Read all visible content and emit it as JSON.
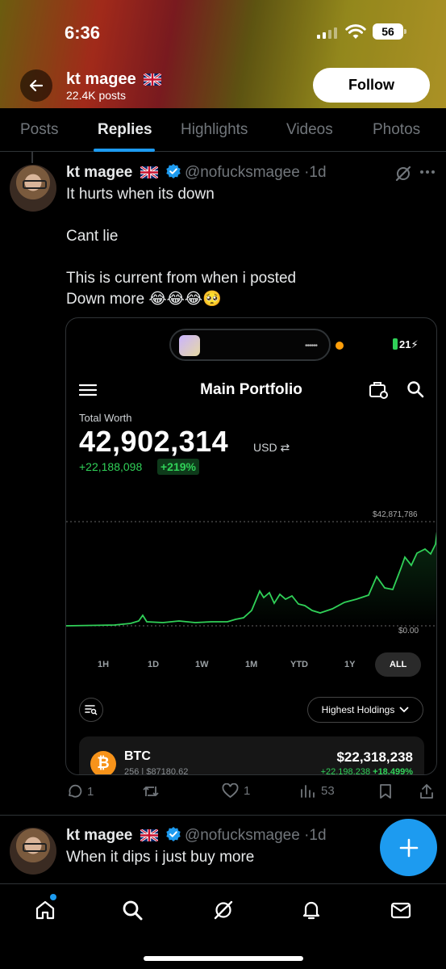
{
  "status_bar": {
    "time": "6:36",
    "battery": "56"
  },
  "header": {
    "name": "kt magee",
    "posts_count": "22.4K posts",
    "follow_label": "Follow"
  },
  "tabs": [
    {
      "label": "Posts"
    },
    {
      "label": "Replies"
    },
    {
      "label": "Highlights"
    },
    {
      "label": "Videos"
    },
    {
      "label": "Photos"
    }
  ],
  "active_tab": "Replies",
  "tweets": [
    {
      "name": "kt magee",
      "handle": "@nofucksmagee",
      "sep": "·",
      "time": "1d",
      "text": "It hurts when its down\n\nCant lie\n\nThis is current from when i posted\nDown more 😂😂😂🥺",
      "stats": {
        "replies": "1",
        "reposts": "",
        "likes": "1",
        "views": "53"
      }
    },
    {
      "name": "kt magee",
      "handle": "@nofucksmagee",
      "sep": "·",
      "time": "1d",
      "text": "When it dips i just buy more"
    }
  ],
  "portfolio": {
    "phone_battery": "21",
    "title": "Main Portfolio",
    "total_label": "Total Worth",
    "total_value": "42,902,314",
    "currency": "USD",
    "change": "+22,188,098",
    "change_pct": "+219%",
    "chart_max": "$42,871,786",
    "chart_min": "$0.00",
    "ranges": [
      "1H",
      "1D",
      "1W",
      "1M",
      "YTD",
      "1Y",
      "ALL"
    ],
    "active_range": "ALL",
    "sort_label": "Highest Holdings",
    "asset": {
      "symbol": "BTC",
      "amount": "256 | $87180.62",
      "value": "$22,318,238",
      "change": "+22,198,238",
      "change_pct": "+18.499%"
    }
  },
  "colors": {
    "accent": "#1d9bf0",
    "positive": "#30d158",
    "background": "#000000"
  },
  "icons": [
    "back-arrow-icon",
    "flag-uk-icon",
    "verified-icon",
    "grok-icon",
    "more-icon",
    "reply-icon",
    "repost-icon",
    "like-icon",
    "views-icon",
    "bookmark-icon",
    "share-icon",
    "compose-icon",
    "home-icon",
    "search-icon",
    "grok-nav-icon",
    "bell-icon",
    "mail-icon"
  ]
}
